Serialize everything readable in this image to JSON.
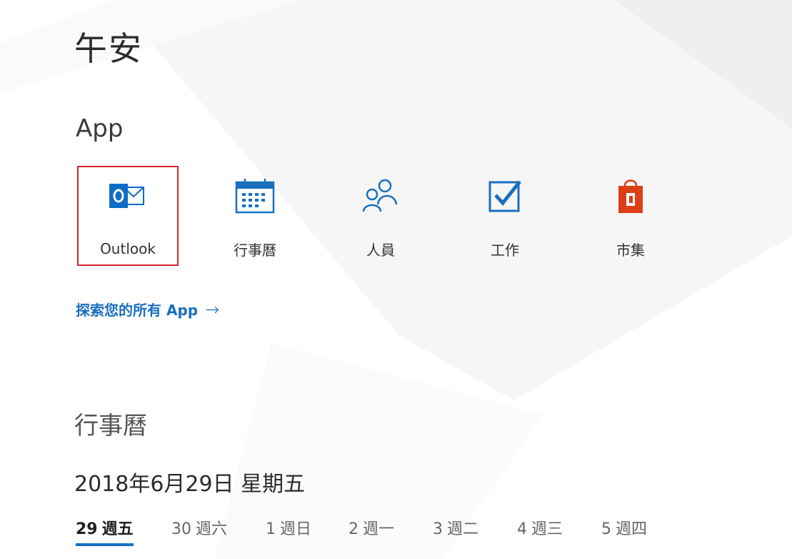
{
  "greeting": "午安",
  "apps_section": {
    "title": "App",
    "selected": "Outlook",
    "items": [
      {
        "id": "outlook",
        "label": "Outlook",
        "icon": "outlook-icon"
      },
      {
        "id": "calendar",
        "label": "行事曆",
        "icon": "calendar-icon"
      },
      {
        "id": "people",
        "label": "人員",
        "icon": "people-icon"
      },
      {
        "id": "tasks",
        "label": "工作",
        "icon": "tasks-checkbox-icon"
      },
      {
        "id": "store",
        "label": "市集",
        "icon": "store-bag-icon"
      }
    ],
    "explore_link": "探索您的所有 App",
    "explore_arrow": "→"
  },
  "calendar_section": {
    "title": "行事曆",
    "date": "2018年6月29日 星期五",
    "selected_day": "29",
    "days": [
      {
        "num": "29",
        "weekday": "週五"
      },
      {
        "num": "30",
        "weekday": "週六"
      },
      {
        "num": "1",
        "weekday": "週日"
      },
      {
        "num": "2",
        "weekday": "週一"
      },
      {
        "num": "3",
        "weekday": "週二"
      },
      {
        "num": "4",
        "weekday": "週三"
      },
      {
        "num": "5",
        "weekday": "週四"
      }
    ]
  },
  "colors": {
    "accent_blue": "#1a6fbf",
    "selection_red": "#d6252d",
    "office_orange": "#dc3e15",
    "outlook_blue": "#0f6cc8"
  }
}
